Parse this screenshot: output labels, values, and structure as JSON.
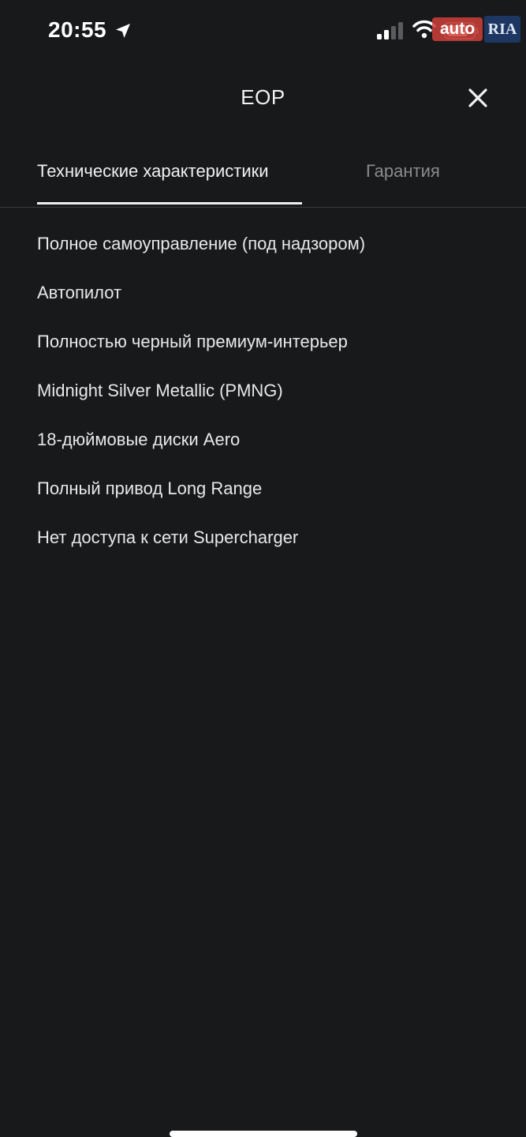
{
  "status_bar": {
    "time": "20:55"
  },
  "watermark": {
    "auto_text": "auto",
    "ria_text": "RIA"
  },
  "header": {
    "title": "EOP"
  },
  "tabs": [
    {
      "label": "Технические характеристики",
      "active": true
    },
    {
      "label": "Гарантия",
      "active": false
    }
  ],
  "specs": [
    "Полное самоуправление (под надзором)",
    "Автопилот",
    "Полностью черный премиум-интерьер",
    "Midnight Silver Metallic (PMNG)",
    "18-дюймовые диски Aero",
    "Полный привод Long Range",
    "Нет доступа к сети Supercharger"
  ],
  "colors": {
    "background": "#18191b",
    "text_primary": "#e8e8ea",
    "text_inactive": "#8a8b8e",
    "divider": "#3a3b3e"
  }
}
